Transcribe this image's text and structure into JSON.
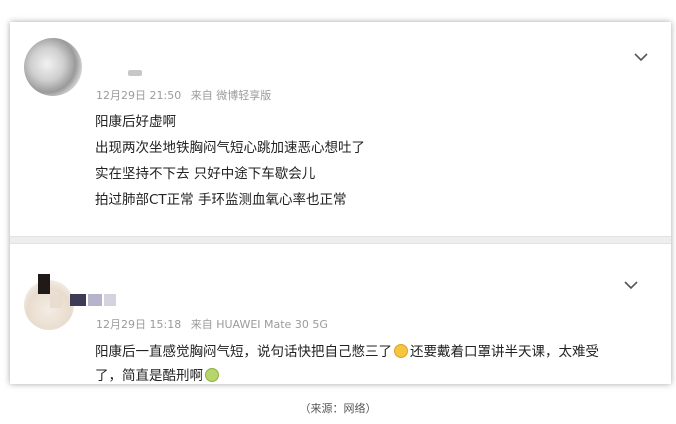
{
  "post1": {
    "username": "",
    "time": "12月29日 21:50",
    "source": "来自 微博轻享版",
    "lines": [
      "阳康后好虚啊",
      "出现两次坐地铁胸闷气短心跳加速恶心想吐了",
      "实在坚持不下去 只好中途下车歇会儿",
      "拍过肺部CT正常 手环监测血氧心率也正常"
    ]
  },
  "post2": {
    "time": "12月29日 15:18",
    "source": "来自 HUAWEI Mate 30 5G",
    "line1_a": "阳康后一直感觉胸闷气短，说句话快把自己憋三了",
    "line1_b": "还要戴着口罩讲半天课，太难受",
    "line2_a": "了，简直是酷刑啊"
  },
  "emojis": [
    "crying-face-icon",
    "nauseated-face-icon"
  ],
  "caption": "（来源：网络）"
}
